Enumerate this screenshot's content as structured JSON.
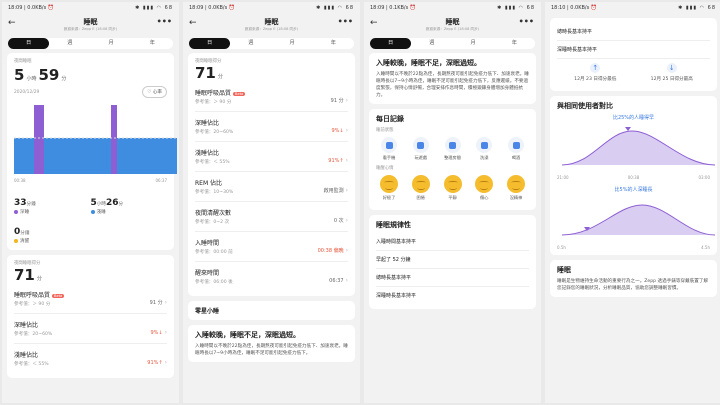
{
  "status": {
    "p1": {
      "left": "18:09 | 0.0KB/s ⏰",
      "right": "✱ ▮▮▮ ◠ 68"
    },
    "p2": {
      "left": "18:09 | 0.0KB/s ⏰",
      "right": "✱ ▮▮▮ ◠ 68"
    },
    "p3": {
      "left": "18:09 | 0.1KB/s ⏰",
      "right": "✱ ▮▮▮ ◠ 68"
    },
    "p4": {
      "left": "18:10 | 0.0KB/s ⏰",
      "right": "✱ ▮▮▮ ◠ 68"
    }
  },
  "header": {
    "title": "睡眠",
    "subtitle": "數據來源：Zepp E (18:08 同步)",
    "back_icon": "←",
    "more_icon": "•••"
  },
  "tabs": [
    "日",
    "週",
    "月",
    "年"
  ],
  "p1": {
    "night_label": "夜間睡眠",
    "hours": "5",
    "hours_unit": "小時",
    "minutes": "59",
    "minutes_unit": "分",
    "date": "2020/12/29",
    "heart_button": "♡ 心率",
    "axis_start": "00:38",
    "axis_end": "06:37",
    "deep_value": "33",
    "deep_unit": "分鐘",
    "deep_label": "深睡",
    "light_hours": "5",
    "light_hours_unit": "小時",
    "light_minutes": "26",
    "light_minutes_unit": "分",
    "light_label": "淺睡",
    "rem_value": "0",
    "rem_unit": "分鐘",
    "rem_label": "清醒",
    "score_label": "夜間睡眠得分",
    "score": "71",
    "score_unit": "分",
    "rows": [
      {
        "title": "睡眠呼吸品質",
        "badge": "Beta",
        "ref": "參考值：＞ 90 分",
        "value": "91 分",
        "red": false
      },
      {
        "title": "深睡佔比",
        "badge": "",
        "ref": "參考值：20~60%",
        "value": "9%",
        "red": true
      },
      {
        "title": "淺睡佔比",
        "badge": "",
        "ref": "參考值：＜ 55%",
        "value": "91%",
        "red": true
      }
    ]
  },
  "p2": {
    "score_label": "夜間睡眠得分",
    "score": "71",
    "score_unit": "分",
    "rows": [
      {
        "title": "睡眠呼吸品質",
        "badge": "Beta",
        "ref": "參考值：＞ 90 分",
        "value": "91 分",
        "red": false
      },
      {
        "title": "深睡佔比",
        "badge": "",
        "ref": "參考值：20~60%",
        "value": "9%",
        "red": true
      },
      {
        "title": "淺睡佔比",
        "badge": "",
        "ref": "參考值：＜ 55%",
        "value": "91%",
        "red": true
      },
      {
        "title": "REM 佔比",
        "badge": "",
        "ref": "參考值：10~30%",
        "value": "啟用監測",
        "red": false
      },
      {
        "title": "夜間清醒次數",
        "badge": "",
        "ref": "參考值：0~2 次",
        "value": "0 次",
        "red": false
      },
      {
        "title": "入睡時間",
        "badge": "",
        "ref": "參考值：00:00 前",
        "value": "00:38 偏晚",
        "red": true
      },
      {
        "title": "醒來時間",
        "badge": "",
        "ref": "參考值：06:00 後",
        "value": "06:37",
        "red": false
      }
    ],
    "nap_title": "零星小睡",
    "advice_title": "入睡較晚，睡眠不足，深眠過短。",
    "advice_text": "入睡時間以不晚於22點為佳，長期熬夜可能引起免疫力低下、加速衰老。睡眠時長以7~9小時為佳，睡眠不足可能引起免疫力低下。"
  },
  "p3": {
    "advice_title": "入睡較晚，睡眠不足，深眠過短。",
    "advice_text": "入睡時間以不晚於22點為佳，長期熬夜可能引起免疫力低下、加速衰老。睡眠時長以7~9小時為佳，睡眠不足可能引起免疫力低下，反應遲緩。不要過度緊張，保持心情舒暢，合理安排作息時間，積極鍛鍊身體增加身體抵抗力。",
    "record_title": "每日記錄",
    "record_sub": "睡前狀態",
    "icons": [
      {
        "label": "看手機",
        "icon": "phone-icon"
      },
      {
        "label": "玩遊戲",
        "icon": "game-icon"
      },
      {
        "label": "整理房間",
        "icon": "tidy-icon"
      },
      {
        "label": "洗澡",
        "icon": "shower-icon"
      },
      {
        "label": "喝酒",
        "icon": "drink-icon"
      }
    ],
    "mood_sub": "睡醒心情",
    "moods": [
      "好極了",
      "困倦",
      "平靜",
      "傷心",
      "沒精神"
    ],
    "pattern_title": "睡眠規律性",
    "pattern_rows": [
      "入睡時間基本持平",
      "早起了 52 分鐘",
      "總時長基本持平",
      "深睡時長基本持平"
    ]
  },
  "p4": {
    "rows": [
      "總時長基本持平",
      "深睡時長基本持平"
    ],
    "trend_left": "12月 23 日得分最低",
    "trend_right": "12月 25 日得分最高",
    "compare_title": "與相同使用者對比",
    "compare1_label": "比25%的人睡得早",
    "axis1": [
      "21:00",
      "00:38",
      "03:00"
    ],
    "compare2_label": "比5%的人深睡長",
    "axis2": [
      "0.5h",
      "4.5h"
    ],
    "info_title": "睡眠",
    "info_text": "睡眠是生物維持生命活動的重要行為之一。Zepp 透過手錶等穿戴裝置了解您記錄您的睡眠狀況，分析睡眠品質，協助您調整睡眠習慣。"
  },
  "colors": {
    "deep": "#8d5fd3",
    "light": "#3f8de0",
    "awake": "#f2b51a",
    "accent_red": "#e4573c",
    "blue": "#3b7be0"
  }
}
